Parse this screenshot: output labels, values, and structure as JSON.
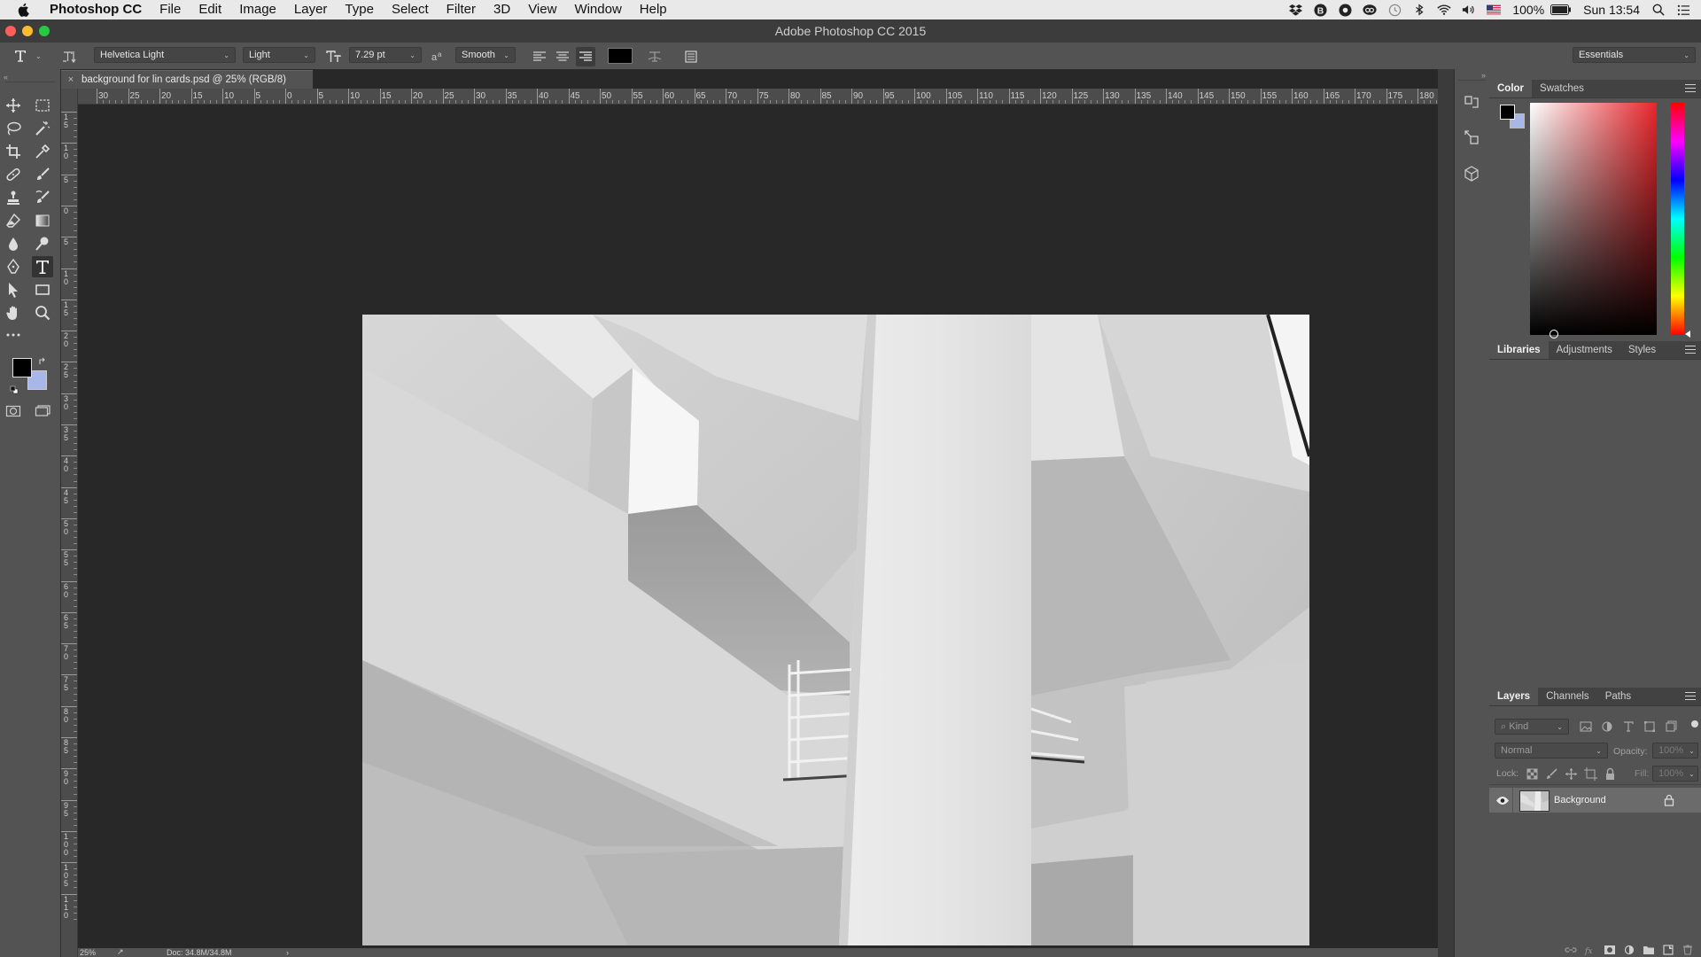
{
  "menubar": {
    "app_name": "Photoshop CC",
    "items": [
      "File",
      "Edit",
      "Image",
      "Layer",
      "Type",
      "Select",
      "Filter",
      "3D",
      "View",
      "Window",
      "Help"
    ],
    "battery": "100%",
    "clock": "Sun 13:54"
  },
  "window": {
    "title": "Adobe Photoshop CC 2015"
  },
  "options_bar": {
    "font_family": "Helvetica Light",
    "font_style": "Light",
    "font_size": "7.29 pt",
    "antialias": "Smooth",
    "text_color": "#000000",
    "workspace": "Essentials"
  },
  "document": {
    "tab_title": "background for lin cards.psd @ 25% (RGB/8)",
    "close_glyph": "×",
    "ruler_h_labels": [
      "30",
      "25",
      "20",
      "15",
      "10",
      "5",
      "0",
      "5",
      "10",
      "15",
      "20",
      "25",
      "30",
      "35",
      "40",
      "45",
      "50",
      "55",
      "60",
      "65",
      "70",
      "75",
      "80",
      "85",
      "90",
      "95",
      "100",
      "105",
      "110",
      "115",
      "120",
      "125",
      "130",
      "135",
      "140",
      "145",
      "150",
      "155",
      "160",
      "165",
      "170",
      "175",
      "180"
    ],
    "ruler_v_labels": [
      "15",
      "10",
      "5",
      "0",
      "5",
      "10",
      "15",
      "20",
      "25",
      "30",
      "35",
      "40",
      "45",
      "50",
      "55",
      "60",
      "65",
      "70",
      "75",
      "80",
      "85",
      "90",
      "95",
      "100",
      "105",
      "110"
    ],
    "zoom": "25%",
    "doc_size": "Doc: 34.8M/34.8M"
  },
  "tools": {
    "foreground_color": "#000000",
    "background_color": "#a9b6e8"
  },
  "color_panel": {
    "tabs": [
      "Color",
      "Swatches"
    ],
    "active_tab": "Color",
    "hue_color": "#e8262b"
  },
  "libraries_panel": {
    "tabs": [
      "Libraries",
      "Adjustments",
      "Styles"
    ],
    "active_tab": "Libraries"
  },
  "layers_panel": {
    "tabs": [
      "Layers",
      "Channels",
      "Paths"
    ],
    "active_tab": "Layers",
    "filter_kind": "Kind",
    "blend_mode": "Normal",
    "opacity_label": "Opacity:",
    "opacity_value": "100%",
    "lock_label": "Lock:",
    "fill_label": "Fill:",
    "fill_value": "100%",
    "layers": [
      {
        "name": "Background",
        "visible": true,
        "locked": true
      }
    ]
  }
}
